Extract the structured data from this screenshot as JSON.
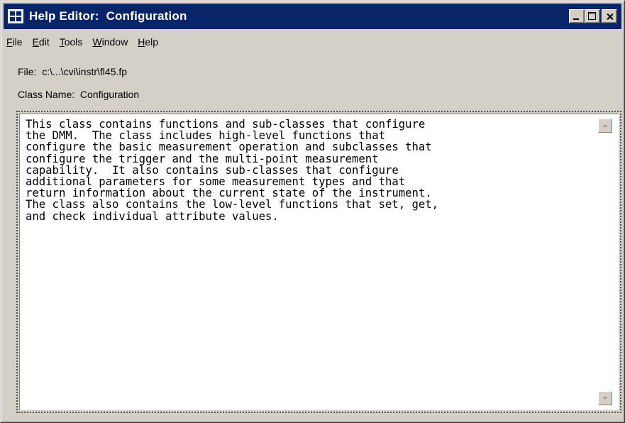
{
  "window": {
    "title": "Help Editor:  Configuration",
    "icon": "app-icon"
  },
  "menu": {
    "items": [
      {
        "hotkey": "F",
        "rest": "ile"
      },
      {
        "hotkey": "E",
        "rest": "dit"
      },
      {
        "hotkey": "T",
        "rest": "ools"
      },
      {
        "hotkey": "W",
        "rest": "indow"
      },
      {
        "hotkey": "H",
        "rest": "elp"
      }
    ]
  },
  "info": {
    "file_line": "File:  c:\\...\\cvi\\instr\\fl45.fp",
    "class_line": "Class Name:  Configuration"
  },
  "editor": {
    "text": "This class contains functions and sub-classes that configure\nthe DMM.  The class includes high-level functions that\nconfigure the basic measurement operation and subclasses that\nconfigure the trigger and the multi-point measurement\ncapability.  It also contains sub-classes that configure\nadditional parameters for some measurement types and that\nreturn information about the current state of the instrument.\nThe class also contains the low-level functions that set, get,\nand check individual attribute values."
  },
  "colors": {
    "titlebar": "#0a246a",
    "face": "#d4d0c8"
  }
}
